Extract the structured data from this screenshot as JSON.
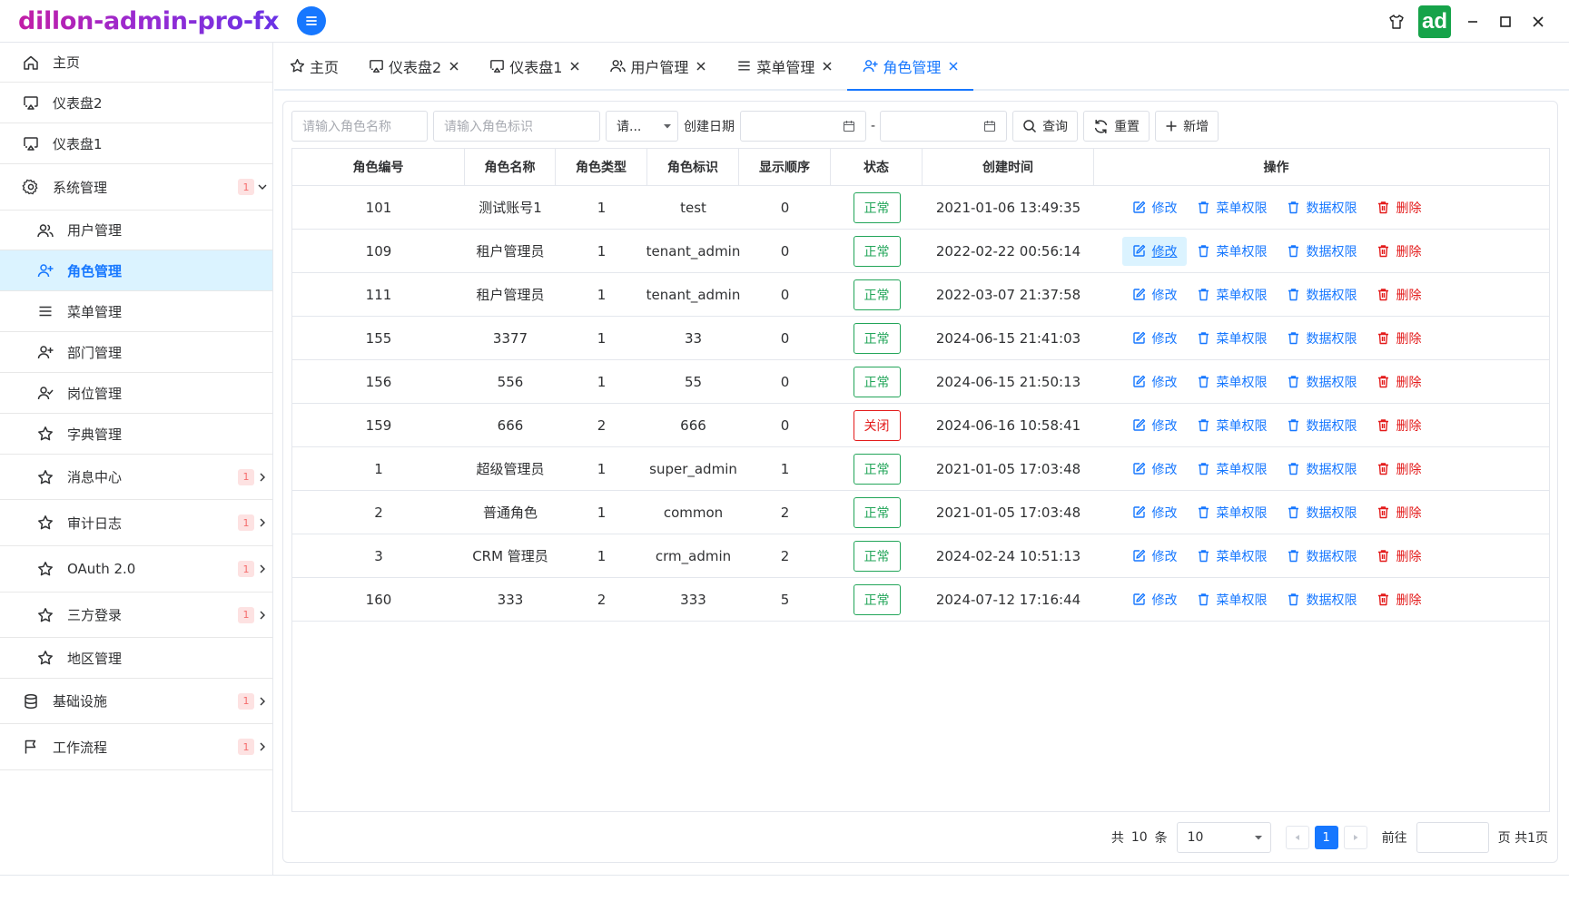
{
  "app": {
    "title": "dillon-admin-pro-fx",
    "avatar_text": "ad"
  },
  "sidebar": {
    "items": [
      {
        "label": "主页",
        "icon": "home-icon"
      },
      {
        "label": "仪表盘2",
        "icon": "monitor-icon"
      },
      {
        "label": "仪表盘1",
        "icon": "monitor-icon"
      },
      {
        "label": "系统管理",
        "icon": "gear-icon",
        "badge": "1",
        "expanded": true
      },
      {
        "label": "用户管理",
        "icon": "users-icon"
      },
      {
        "label": "角色管理",
        "icon": "user-plus-icon",
        "active": true
      },
      {
        "label": "菜单管理",
        "icon": "menu-icon"
      },
      {
        "label": "部门管理",
        "icon": "user-plus-icon"
      },
      {
        "label": "岗位管理",
        "icon": "user-check-icon"
      },
      {
        "label": "字典管理",
        "icon": "star-icon"
      },
      {
        "label": "消息中心",
        "icon": "star-icon",
        "badge": "1"
      },
      {
        "label": "审计日志",
        "icon": "star-icon",
        "badge": "1"
      },
      {
        "label": "OAuth 2.0",
        "icon": "star-icon",
        "badge": "1"
      },
      {
        "label": "三方登录",
        "icon": "star-icon",
        "badge": "1"
      },
      {
        "label": "地区管理",
        "icon": "star-icon"
      },
      {
        "label": "基础设施",
        "icon": "database-icon",
        "badge": "1"
      },
      {
        "label": "工作流程",
        "icon": "flag-icon",
        "badge": "1"
      }
    ]
  },
  "tabs": [
    {
      "label": "主页",
      "icon": "star-icon",
      "closable": false
    },
    {
      "label": "仪表盘2",
      "icon": "monitor-icon",
      "closable": true
    },
    {
      "label": "仪表盘1",
      "icon": "monitor-icon",
      "closable": true
    },
    {
      "label": "用户管理",
      "icon": "users-icon",
      "closable": true
    },
    {
      "label": "菜单管理",
      "icon": "menu-icon",
      "closable": true
    },
    {
      "label": "角色管理",
      "icon": "user-plus-icon",
      "closable": true,
      "active": true
    }
  ],
  "search": {
    "role_name_placeholder": "请输入角色名称",
    "role_key_placeholder": "请输入角色标识",
    "status_select": "请...",
    "date_label": "创建日期",
    "date_sep": "-",
    "query_label": "查询",
    "reset_label": "重置",
    "add_label": "新增"
  },
  "table": {
    "headers": [
      "角色编号",
      "角色名称",
      "角色类型",
      "角色标识",
      "显示顺序",
      "状态",
      "创建时间",
      "操作"
    ],
    "rows": [
      [
        "101",
        "测试账号1",
        "1",
        "test",
        "0",
        "正常",
        "2021-01-06 13:49:35"
      ],
      [
        "109",
        "租户管理员",
        "1",
        "tenant_admin",
        "0",
        "正常",
        "2022-02-22 00:56:14"
      ],
      [
        "111",
        "租户管理员",
        "1",
        "tenant_admin",
        "0",
        "正常",
        "2022-03-07 21:37:58"
      ],
      [
        "155",
        "3377",
        "1",
        "33",
        "0",
        "正常",
        "2024-06-15 21:41:03"
      ],
      [
        "156",
        "556",
        "1",
        "55",
        "0",
        "正常",
        "2024-06-15 21:50:13"
      ],
      [
        "159",
        "666",
        "2",
        "666",
        "0",
        "关闭",
        "2024-06-16 10:58:41"
      ],
      [
        "1",
        "超级管理员",
        "1",
        "super_admin",
        "1",
        "正常",
        "2021-01-05 17:03:48"
      ],
      [
        "2",
        "普通角色",
        "1",
        "common",
        "2",
        "正常",
        "2021-01-05 17:03:48"
      ],
      [
        "3",
        "CRM 管理员",
        "1",
        "crm_admin",
        "2",
        "正常",
        "2024-02-24 10:51:13"
      ],
      [
        "160",
        "333",
        "2",
        "333",
        "5",
        "正常",
        "2024-07-12 17:16:44"
      ]
    ],
    "actions": {
      "edit": "修改",
      "menu_perm": "菜单权限",
      "data_perm": "数据权限",
      "delete": "删除"
    },
    "hover_row": 1
  },
  "pagination": {
    "total_prefix": "共",
    "total": "10",
    "total_suffix": "条",
    "page_size": "10",
    "current_page": "1",
    "goto_label": "前往",
    "pages_label": "页 共1页"
  },
  "colors": {
    "primary": "#1677ff",
    "success": "#22a559",
    "danger": "#e31b1b",
    "active_bg": "#dbf3ff"
  }
}
